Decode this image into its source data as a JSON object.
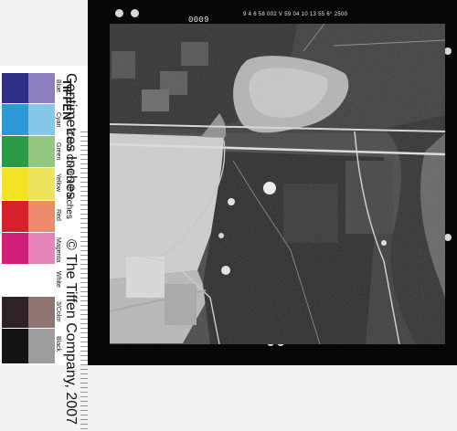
{
  "frame": {
    "number": "0009",
    "info": "9 4 6    58 002 V     59 04 10    13 55    6°    2500"
  },
  "color_chart": {
    "brand": "TIFFEN",
    "title": "Color Control Patches",
    "ruler_text": "Centimetres   Inches",
    "copyright": "© The Tiffen Company, 2007",
    "patches": [
      {
        "label": "Blue",
        "color": "#2e2e84"
      },
      {
        "label": "Cyan",
        "color": "#2c9ad6"
      },
      {
        "label": "Green",
        "color": "#2a9a47"
      },
      {
        "label": "Yellow",
        "color": "#f2e526"
      },
      {
        "label": "Red",
        "color": "#d7202d"
      },
      {
        "label": "Magenta",
        "color": "#cf1f78"
      },
      {
        "label": "White",
        "color": "#ffffff"
      },
      {
        "label": "3/Color",
        "color": "#2e2228"
      },
      {
        "label": "Black",
        "color": "#141414"
      }
    ],
    "secondary_colors": [
      "#8f7fc0",
      "#86c8ea",
      "#93c77f",
      "#efe45d",
      "#ef8b6d",
      "#e785b7",
      "#ffffff",
      "#8f7571",
      "#9d9d9d"
    ]
  }
}
